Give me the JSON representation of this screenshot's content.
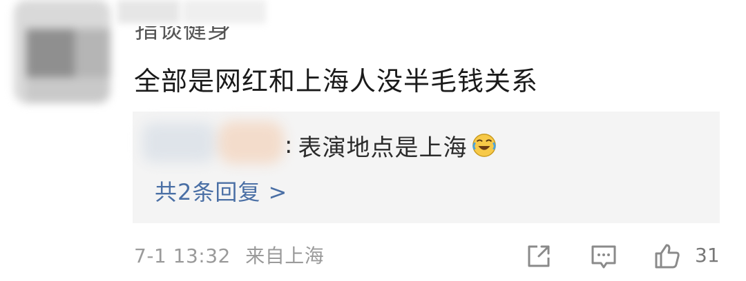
{
  "comment": {
    "username": "指谈健身",
    "text": "全部是网红和上海人没半毛钱关系",
    "reply_preview": {
      "colon": ":",
      "text": "表演地点是上海",
      "emoji": "laughing-crying-emoji"
    },
    "reply_count_label": "共2条回复 >",
    "timestamp": "7-1 13:32",
    "location": "来自上海",
    "like_count": "31"
  },
  "icons": {
    "share": "share-icon",
    "comment": "comment-icon",
    "like": "thumbs-up-icon"
  },
  "colors": {
    "link": "#4a6fa5",
    "meta": "#9a9a9a",
    "reply_bg": "#f4f4f4"
  }
}
